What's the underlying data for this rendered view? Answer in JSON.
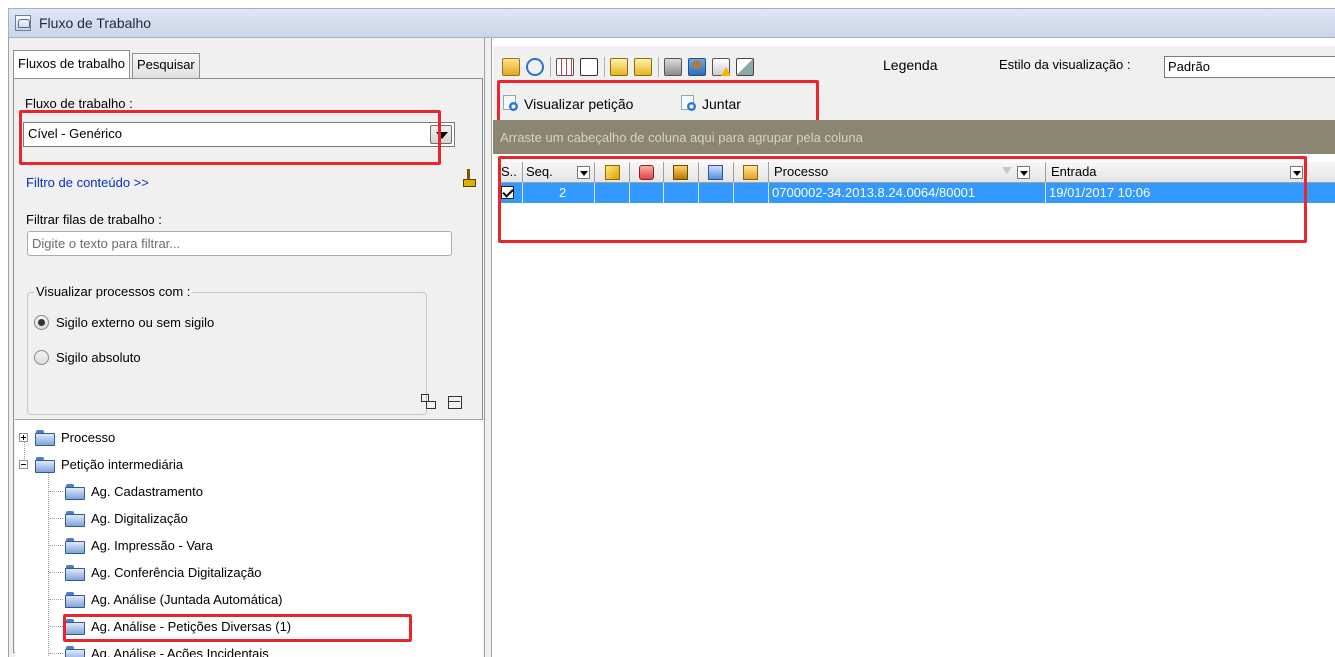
{
  "window": {
    "title": "Fluxo de Trabalho"
  },
  "left_panel": {
    "tabs": [
      {
        "label": "Fluxos de trabalho"
      },
      {
        "label": "Pesquisar"
      }
    ],
    "workflow_label": "Fluxo de trabalho :",
    "workflow_value": "Cível - Genérico",
    "content_filter_link": "Filtro de conteúdo >>",
    "queue_filter_label": "Filtrar filas de trabalho :",
    "queue_filter_placeholder": "Digite o texto para filtrar...",
    "view_group": {
      "legend": "Visualizar processos com :",
      "options": [
        {
          "label": "Sigilo externo ou sem sigilo",
          "checked": true
        },
        {
          "label": "Sigilo absoluto",
          "checked": false
        }
      ]
    },
    "tree": [
      {
        "label": "Processo",
        "level": 0,
        "toggle": "plus"
      },
      {
        "label": "Petição intermediária",
        "level": 0,
        "toggle": "minus"
      },
      {
        "label": "Ag. Cadastramento",
        "level": 1
      },
      {
        "label": "Ag. Digitalização",
        "level": 1
      },
      {
        "label": "Ag. Impressão - Vara",
        "level": 1
      },
      {
        "label": "Ag. Conferência Digitalização",
        "level": 1
      },
      {
        "label": "Ag. Análise (Juntada Automática)",
        "level": 1
      },
      {
        "label": "Ag. Análise - Petições Diversas (1)",
        "level": 1
      },
      {
        "label": "Ag. Análise - Ações Incidentais",
        "level": 1
      }
    ]
  },
  "right_panel": {
    "toolbar": {
      "legend_label": "Legenda",
      "view_style_label": "Estilo da visualização :",
      "view_style_value": "Padrão"
    },
    "actions": {
      "view_petition": "Visualizar petição",
      "attach": "Juntar"
    },
    "group_hint": "Arraste um cabeçalho de coluna aqui para agrupar pela coluna",
    "grid": {
      "headers": {
        "s": "S..",
        "seq": "Seq.",
        "processo": "Processo",
        "entrada": "Entrada"
      },
      "rows": [
        {
          "checked": true,
          "seq": "2",
          "processo": "0700002-34.2013.8.24.0064/80001",
          "entrada": "19/01/2017 10:06"
        }
      ]
    }
  },
  "colors": {
    "highlight": "#e8262b",
    "selection": "#3399ff",
    "link": "#0a2ec8",
    "group_bar": "#8c8571"
  }
}
